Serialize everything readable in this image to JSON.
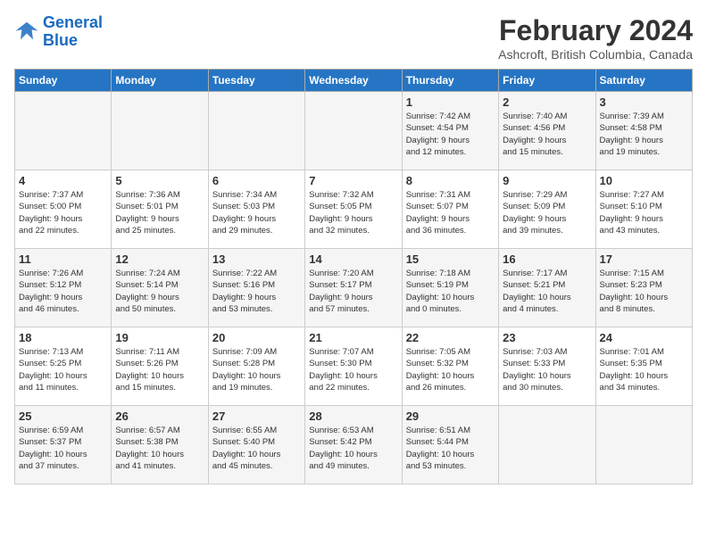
{
  "logo": {
    "line1": "General",
    "line2": "Blue"
  },
  "title": "February 2024",
  "location": "Ashcroft, British Columbia, Canada",
  "days_of_week": [
    "Sunday",
    "Monday",
    "Tuesday",
    "Wednesday",
    "Thursday",
    "Friday",
    "Saturday"
  ],
  "weeks": [
    [
      {
        "day": "",
        "info": ""
      },
      {
        "day": "",
        "info": ""
      },
      {
        "day": "",
        "info": ""
      },
      {
        "day": "",
        "info": ""
      },
      {
        "day": "1",
        "info": "Sunrise: 7:42 AM\nSunset: 4:54 PM\nDaylight: 9 hours\nand 12 minutes."
      },
      {
        "day": "2",
        "info": "Sunrise: 7:40 AM\nSunset: 4:56 PM\nDaylight: 9 hours\nand 15 minutes."
      },
      {
        "day": "3",
        "info": "Sunrise: 7:39 AM\nSunset: 4:58 PM\nDaylight: 9 hours\nand 19 minutes."
      }
    ],
    [
      {
        "day": "4",
        "info": "Sunrise: 7:37 AM\nSunset: 5:00 PM\nDaylight: 9 hours\nand 22 minutes."
      },
      {
        "day": "5",
        "info": "Sunrise: 7:36 AM\nSunset: 5:01 PM\nDaylight: 9 hours\nand 25 minutes."
      },
      {
        "day": "6",
        "info": "Sunrise: 7:34 AM\nSunset: 5:03 PM\nDaylight: 9 hours\nand 29 minutes."
      },
      {
        "day": "7",
        "info": "Sunrise: 7:32 AM\nSunset: 5:05 PM\nDaylight: 9 hours\nand 32 minutes."
      },
      {
        "day": "8",
        "info": "Sunrise: 7:31 AM\nSunset: 5:07 PM\nDaylight: 9 hours\nand 36 minutes."
      },
      {
        "day": "9",
        "info": "Sunrise: 7:29 AM\nSunset: 5:09 PM\nDaylight: 9 hours\nand 39 minutes."
      },
      {
        "day": "10",
        "info": "Sunrise: 7:27 AM\nSunset: 5:10 PM\nDaylight: 9 hours\nand 43 minutes."
      }
    ],
    [
      {
        "day": "11",
        "info": "Sunrise: 7:26 AM\nSunset: 5:12 PM\nDaylight: 9 hours\nand 46 minutes."
      },
      {
        "day": "12",
        "info": "Sunrise: 7:24 AM\nSunset: 5:14 PM\nDaylight: 9 hours\nand 50 minutes."
      },
      {
        "day": "13",
        "info": "Sunrise: 7:22 AM\nSunset: 5:16 PM\nDaylight: 9 hours\nand 53 minutes."
      },
      {
        "day": "14",
        "info": "Sunrise: 7:20 AM\nSunset: 5:17 PM\nDaylight: 9 hours\nand 57 minutes."
      },
      {
        "day": "15",
        "info": "Sunrise: 7:18 AM\nSunset: 5:19 PM\nDaylight: 10 hours\nand 0 minutes."
      },
      {
        "day": "16",
        "info": "Sunrise: 7:17 AM\nSunset: 5:21 PM\nDaylight: 10 hours\nand 4 minutes."
      },
      {
        "day": "17",
        "info": "Sunrise: 7:15 AM\nSunset: 5:23 PM\nDaylight: 10 hours\nand 8 minutes."
      }
    ],
    [
      {
        "day": "18",
        "info": "Sunrise: 7:13 AM\nSunset: 5:25 PM\nDaylight: 10 hours\nand 11 minutes."
      },
      {
        "day": "19",
        "info": "Sunrise: 7:11 AM\nSunset: 5:26 PM\nDaylight: 10 hours\nand 15 minutes."
      },
      {
        "day": "20",
        "info": "Sunrise: 7:09 AM\nSunset: 5:28 PM\nDaylight: 10 hours\nand 19 minutes."
      },
      {
        "day": "21",
        "info": "Sunrise: 7:07 AM\nSunset: 5:30 PM\nDaylight: 10 hours\nand 22 minutes."
      },
      {
        "day": "22",
        "info": "Sunrise: 7:05 AM\nSunset: 5:32 PM\nDaylight: 10 hours\nand 26 minutes."
      },
      {
        "day": "23",
        "info": "Sunrise: 7:03 AM\nSunset: 5:33 PM\nDaylight: 10 hours\nand 30 minutes."
      },
      {
        "day": "24",
        "info": "Sunrise: 7:01 AM\nSunset: 5:35 PM\nDaylight: 10 hours\nand 34 minutes."
      }
    ],
    [
      {
        "day": "25",
        "info": "Sunrise: 6:59 AM\nSunset: 5:37 PM\nDaylight: 10 hours\nand 37 minutes."
      },
      {
        "day": "26",
        "info": "Sunrise: 6:57 AM\nSunset: 5:38 PM\nDaylight: 10 hours\nand 41 minutes."
      },
      {
        "day": "27",
        "info": "Sunrise: 6:55 AM\nSunset: 5:40 PM\nDaylight: 10 hours\nand 45 minutes."
      },
      {
        "day": "28",
        "info": "Sunrise: 6:53 AM\nSunset: 5:42 PM\nDaylight: 10 hours\nand 49 minutes."
      },
      {
        "day": "29",
        "info": "Sunrise: 6:51 AM\nSunset: 5:44 PM\nDaylight: 10 hours\nand 53 minutes."
      },
      {
        "day": "",
        "info": ""
      },
      {
        "day": "",
        "info": ""
      }
    ]
  ]
}
